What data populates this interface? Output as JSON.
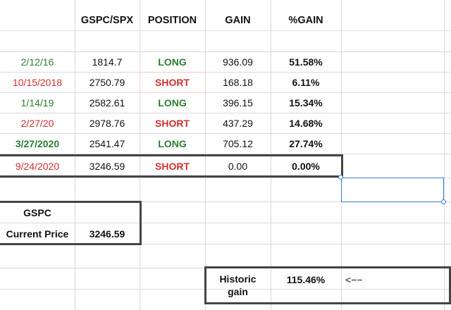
{
  "headers": {
    "index": "GSPC/SPX",
    "position": "POSITION",
    "gain": "GAIN",
    "pct_gain": "%GAIN"
  },
  "rows": [
    {
      "date": "2/12/16",
      "price": "1814.7",
      "position": "LONG",
      "gain": "936.09",
      "pct": "51.58%",
      "date_color": "green",
      "pos_color": "green"
    },
    {
      "date": "10/15/2018",
      "price": "2750.79",
      "position": "SHORT",
      "gain": "168.18",
      "pct": "6.11%",
      "date_color": "red",
      "pos_color": "red"
    },
    {
      "date": "1/14/19",
      "price": "2582.61",
      "position": "LONG",
      "gain": "396.15",
      "pct": "15.34%",
      "date_color": "green",
      "pos_color": "green"
    },
    {
      "date": "2/27/20",
      "price": "2978.76",
      "position": "SHORT",
      "gain": "437.29",
      "pct": "14.68%",
      "date_color": "red",
      "pos_color": "red"
    },
    {
      "date": "3/27/2020",
      "price": "2541.47",
      "position": "LONG",
      "gain": "705.12",
      "pct": "27.74%",
      "date_color": "green",
      "pos_color": "green"
    },
    {
      "date": "9/24/2020",
      "price": "3246.59",
      "position": "SHORT",
      "gain": "0.00",
      "pct": "0.00%",
      "date_color": "red",
      "pos_color": "red"
    }
  ],
  "summary": {
    "symbol": "GSPC",
    "current_price_label": "Current Price",
    "current_price": "3246.59"
  },
  "historic": {
    "label_line1": "Historic",
    "label_line2": "gain",
    "value": "115.46%",
    "arrow": "<−−"
  },
  "colors": {
    "green": "#2e7d32",
    "red": "#d32f2f",
    "border": "#444444",
    "selection": "#3a7bd5"
  }
}
